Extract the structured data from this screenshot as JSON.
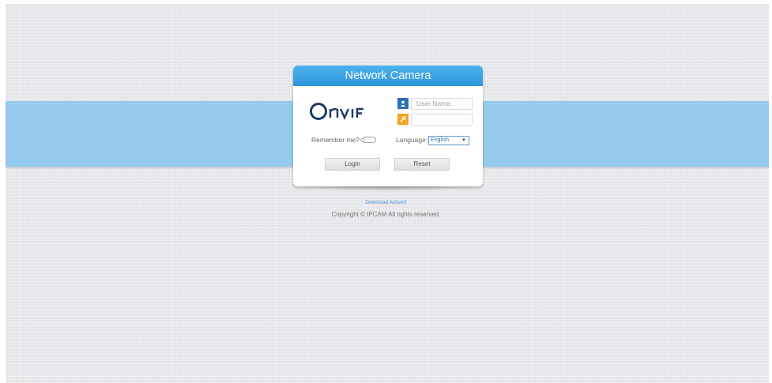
{
  "card": {
    "title": "Network Camera",
    "logo": "ONVIF",
    "username_placeholder": "User Name",
    "password_value": "",
    "remember_label": "Remember me?",
    "remember_checked": false,
    "language_label": "Language:",
    "language_selected": "English",
    "login_label": "Login",
    "reset_label": "Reset"
  },
  "icons": {
    "user": "user-icon",
    "password": "key-icon",
    "dropdown": "chevron-down-icon"
  },
  "footer": {
    "download_link": "Download ActiveX",
    "copyright": "Copyright © IPCAM All rights reserved."
  },
  "colors": {
    "header": "#2d95db",
    "band": "#94cbee",
    "background": "#e4e5e8",
    "user_icon_bg": "#2b6fb5",
    "key_icon_bg": "#f3a623",
    "link": "#4a90d9"
  }
}
